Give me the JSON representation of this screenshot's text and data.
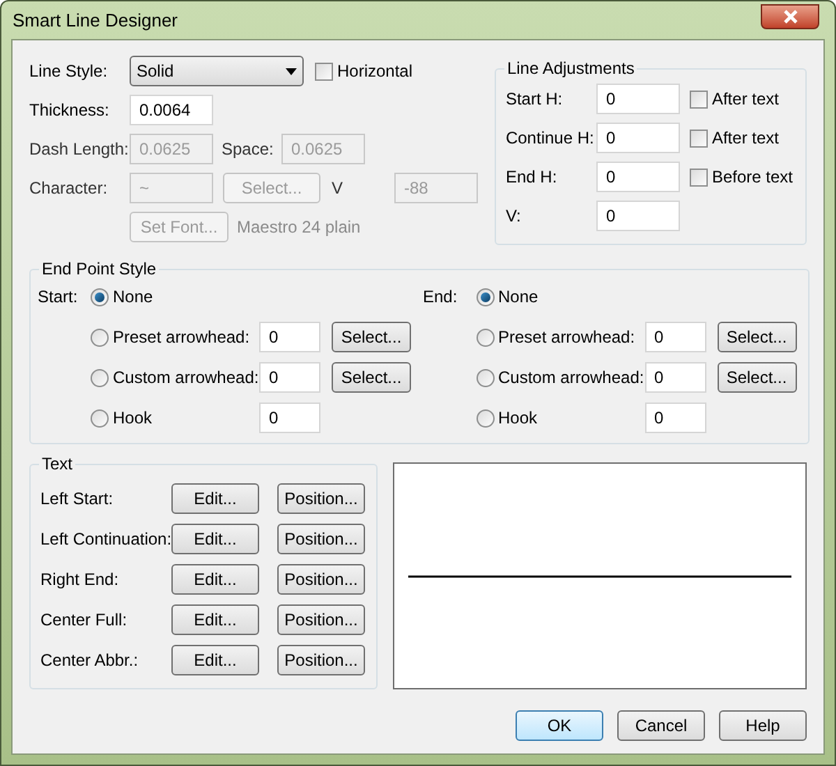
{
  "window": {
    "title": "Smart Line Designer"
  },
  "line_style": {
    "label": "Line Style:",
    "value": "Solid"
  },
  "horizontal": {
    "label": "Horizontal",
    "checked": false
  },
  "thickness": {
    "label": "Thickness:",
    "value": "0.0064"
  },
  "dash_length": {
    "label": "Dash Length:",
    "value": "0.0625",
    "disabled": true
  },
  "space": {
    "label": "Space:",
    "value": "0.0625",
    "disabled": true
  },
  "character": {
    "label": "Character:",
    "value": "~",
    "disabled": true
  },
  "character_select": {
    "label": "Select...",
    "disabled": true
  },
  "v": {
    "label": "V",
    "value": "-88",
    "disabled": true
  },
  "set_font": {
    "label": "Set Font...",
    "disabled": true
  },
  "font_name": "Maestro 24 plain",
  "line_adjustments": {
    "title": "Line Adjustments",
    "rows": [
      {
        "label": "Start H:",
        "value": "0",
        "checkbox": {
          "label": "After text",
          "checked": false
        }
      },
      {
        "label": "Continue H:",
        "value": "0",
        "checkbox": {
          "label": "After text",
          "checked": false
        }
      },
      {
        "label": "End H:",
        "value": "0",
        "checkbox": {
          "label": "Before text",
          "checked": false
        }
      },
      {
        "label": "V:",
        "value": "0"
      }
    ]
  },
  "end_point_style": {
    "title": "End Point Style",
    "sides": [
      {
        "label": "Start:",
        "options": [
          {
            "label": "None",
            "selected": true
          },
          {
            "label": "Preset arrowhead:",
            "selected": false,
            "value": "0",
            "button": "Select..."
          },
          {
            "label": "Custom arrowhead:",
            "selected": false,
            "value": "0",
            "button": "Select..."
          },
          {
            "label": "Hook",
            "selected": false,
            "value": "0"
          }
        ]
      },
      {
        "label": "End:",
        "options": [
          {
            "label": "None",
            "selected": true
          },
          {
            "label": "Preset arrowhead:",
            "selected": false,
            "value": "0",
            "button": "Select..."
          },
          {
            "label": "Custom arrowhead:",
            "selected": false,
            "value": "0",
            "button": "Select..."
          },
          {
            "label": "Hook",
            "selected": false,
            "value": "0"
          }
        ]
      }
    ]
  },
  "text": {
    "title": "Text",
    "rows": [
      {
        "label": "Left Start:",
        "edit": "Edit...",
        "position": "Position..."
      },
      {
        "label": "Left Continuation:",
        "edit": "Edit...",
        "position": "Position..."
      },
      {
        "label": "Right End:",
        "edit": "Edit...",
        "position": "Position..."
      },
      {
        "label": "Center Full:",
        "edit": "Edit...",
        "position": "Position..."
      },
      {
        "label": "Center Abbr.:",
        "edit": "Edit...",
        "position": "Position..."
      }
    ]
  },
  "buttons": [
    {
      "label": "OK",
      "default": true
    },
    {
      "label": "Cancel",
      "default": false
    },
    {
      "label": "Help",
      "default": false
    }
  ]
}
